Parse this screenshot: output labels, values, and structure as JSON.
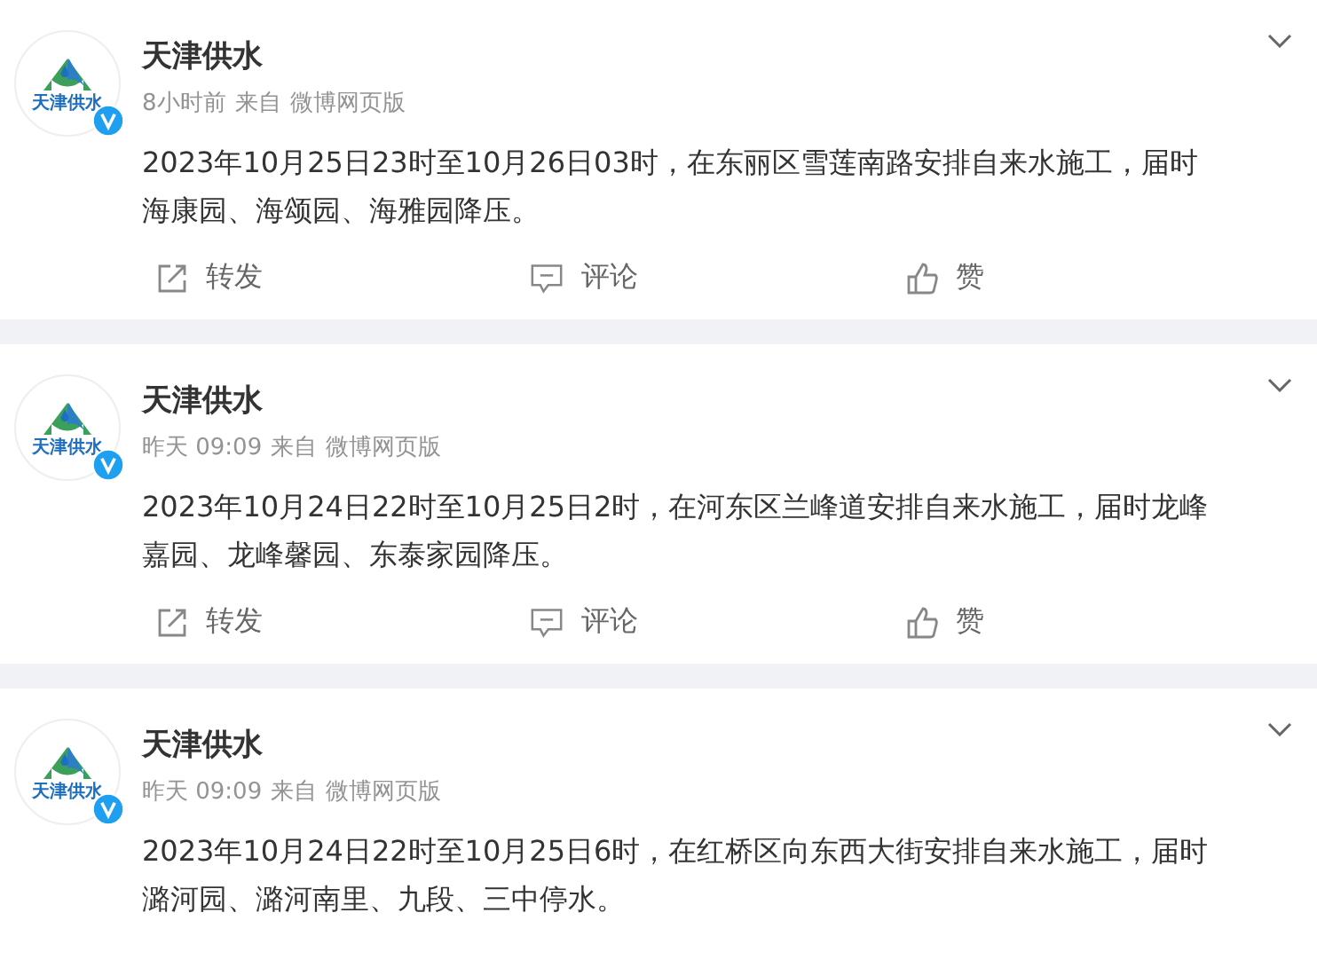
{
  "posts": [
    {
      "author": "天津供水",
      "logo_text": "天津供水",
      "verified": true,
      "time": "8小时前",
      "source_prefix": "来自",
      "source": "微博网页版",
      "text": "2023年10月25日23时至10月26日03时，在东丽区雪莲南路安排自来水施工，届时海康园、海颂园、海雅园降压。",
      "actions": [
        {
          "kind": "repost",
          "label": "转发"
        },
        {
          "kind": "comment",
          "label": "评论"
        },
        {
          "kind": "like",
          "label": "赞"
        }
      ]
    },
    {
      "author": "天津供水",
      "logo_text": "天津供水",
      "verified": true,
      "time": "昨天 09:09",
      "source_prefix": "来自",
      "source": "微博网页版",
      "text": "2023年10月24日22时至10月25日2时，在河东区兰峰道安排自来水施工，届时龙峰嘉园、龙峰馨园、东泰家园降压。",
      "actions": [
        {
          "kind": "repost",
          "label": "转发"
        },
        {
          "kind": "comment",
          "label": "评论"
        },
        {
          "kind": "like",
          "label": "赞"
        }
      ]
    },
    {
      "author": "天津供水",
      "logo_text": "天津供水",
      "verified": true,
      "time": "昨天 09:09",
      "source_prefix": "来自",
      "source": "微博网页版",
      "text": "2023年10月24日22时至10月25日6时，在红桥区向东西大街安排自来水施工，届时潞河园、潞河南里、九段、三中停水。"
    }
  ]
}
